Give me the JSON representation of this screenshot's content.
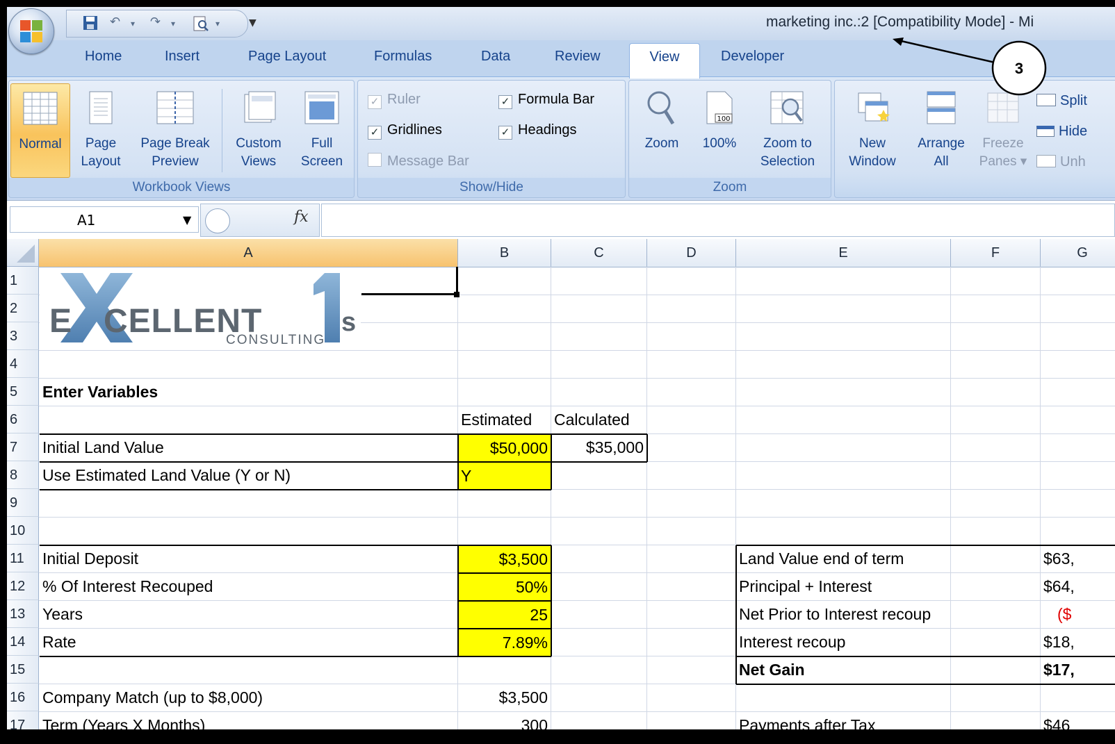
{
  "window": {
    "title": "marketing inc.:2  [Compatibility Mode] - Mi",
    "callout_number": "3"
  },
  "tabs": [
    "Home",
    "Insert",
    "Page Layout",
    "Formulas",
    "Data",
    "Review",
    "View",
    "Developer"
  ],
  "active_tab": "View",
  "ribbon": {
    "workbook_views": {
      "label": "Workbook Views",
      "normal": "Normal",
      "page_layout_1": "Page",
      "page_layout_2": "Layout",
      "page_break_1": "Page Break",
      "page_break_2": "Preview",
      "custom_views_1": "Custom",
      "custom_views_2": "Views",
      "full_screen_1": "Full",
      "full_screen_2": "Screen"
    },
    "show_hide": {
      "label": "Show/Hide",
      "ruler": "Ruler",
      "ruler_checked": true,
      "ruler_disabled": true,
      "gridlines": "Gridlines",
      "gridlines_checked": true,
      "message_bar": "Message Bar",
      "message_bar_checked": false,
      "message_bar_disabled": true,
      "formula_bar": "Formula Bar",
      "formula_bar_checked": true,
      "headings": "Headings",
      "headings_checked": true
    },
    "zoom": {
      "label": "Zoom",
      "zoom": "Zoom",
      "hundred": "100%",
      "hundred_icon_text": "100",
      "zoom_sel_1": "Zoom to",
      "zoom_sel_2": "Selection"
    },
    "window_group": {
      "new_window_1": "New",
      "new_window_2": "Window",
      "arrange_1": "Arrange",
      "arrange_2": "All",
      "freeze_1": "Freeze",
      "freeze_2": "Panes ▾",
      "split": "Split",
      "hide": "Hide",
      "unhide": "Unh"
    }
  },
  "formula_bar": {
    "name_box": "A1",
    "fx": "fx",
    "formula": ""
  },
  "columns": [
    "A",
    "B",
    "C",
    "D",
    "E",
    "F",
    "G"
  ],
  "rows": [
    "1",
    "2",
    "3",
    "4",
    "5",
    "6",
    "7",
    "8",
    "9",
    "10",
    "11",
    "12",
    "13",
    "14",
    "15",
    "16",
    "17"
  ],
  "logo": {
    "text_left": "E",
    "text_mid": "CELLENT",
    "text_s": "s",
    "sub": "CONSULTING"
  },
  "cells": {
    "A5": "Enter Variables",
    "B6": "Estimated",
    "C6": "Calculated",
    "A7": "Initial Land Value",
    "B7": "$50,000",
    "C7": "$35,000",
    "A8": "Use Estimated Land Value (Y or N)",
    "B8": "Y",
    "A11": "Initial Deposit",
    "B11": "$3,500",
    "A12": "% Of Interest Recouped",
    "B12": "50%",
    "A13": "Years",
    "B13": "25",
    "A14": "Rate",
    "B14": "7.89%",
    "A16": "Company Match (up to $8,000)",
    "B16": "$3,500",
    "A17": "Term (Years X Months)",
    "B17": "300",
    "E11": "Land Value end of term",
    "G11": "$63,",
    "E12": "Principal + Interest",
    "G12": "$64,",
    "E13": "Net Prior to Interest recoup",
    "G13": "($",
    "E14": "Interest recoup",
    "G14": "$18,",
    "E15": "Net Gain",
    "G15": "$17,",
    "E17": "Payments after Tax",
    "G17": "$46"
  },
  "colors": {
    "highlight": "#ffff00",
    "ribbon_blue": "#15428b",
    "negative": "#e00000"
  }
}
